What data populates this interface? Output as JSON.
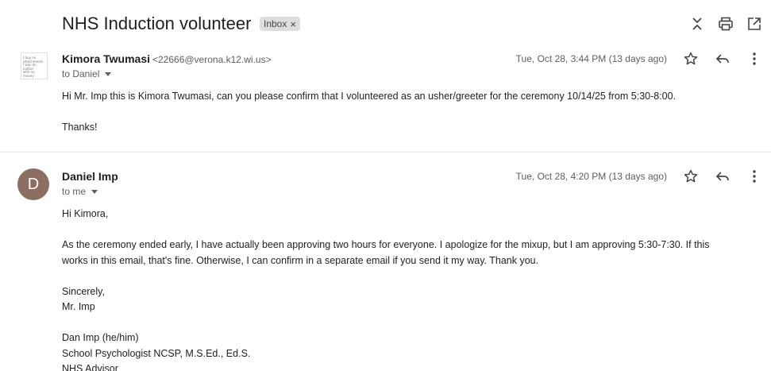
{
  "thread": {
    "subject": "NHS Induction volunteer",
    "label": "Inbox",
    "label_remove": "×"
  },
  "icons": {
    "collapse": "collapse-all-icon",
    "print": "print-icon",
    "new_window": "open-in-new-window-icon"
  },
  "messages": [
    {
      "sender": "Kimora Twumasi",
      "email": "<22666@verona.k12.wi.us>",
      "to": "to Daniel",
      "date": "Tue, Oct 28, 3:44 PM (13 days ago)",
      "lines": [
        "Hi Mr. Imp this is Kimora Twumasi, can you please confirm that I volunteered as an usher/greeter for the ceremony 10/14/25 from 5:30-8:00.",
        "",
        "Thanks!"
      ]
    },
    {
      "sender": "Daniel Imp",
      "avatar_letter": "D",
      "avatar_color": "#8d6e63",
      "to": "to me",
      "date": "Tue, Oct 28, 4:20 PM (13 days ago)",
      "lines": [
        "Hi Kimora,",
        "",
        "As the ceremony ended early, I have actually been approving two hours for everyone. I apologize for the mixup, but I am approving 5:30-7:30. If this",
        "works in this email, that's fine. Otherwise, I can confirm in a separate email if you send it my way. Thank you.",
        "",
        "Sincerely,",
        "Mr. Imp",
        "",
        "Dan Imp (he/him)",
        "School Psychologist NCSP, M.S.Ed., Ed.S.",
        "NHS Advisor"
      ]
    }
  ]
}
